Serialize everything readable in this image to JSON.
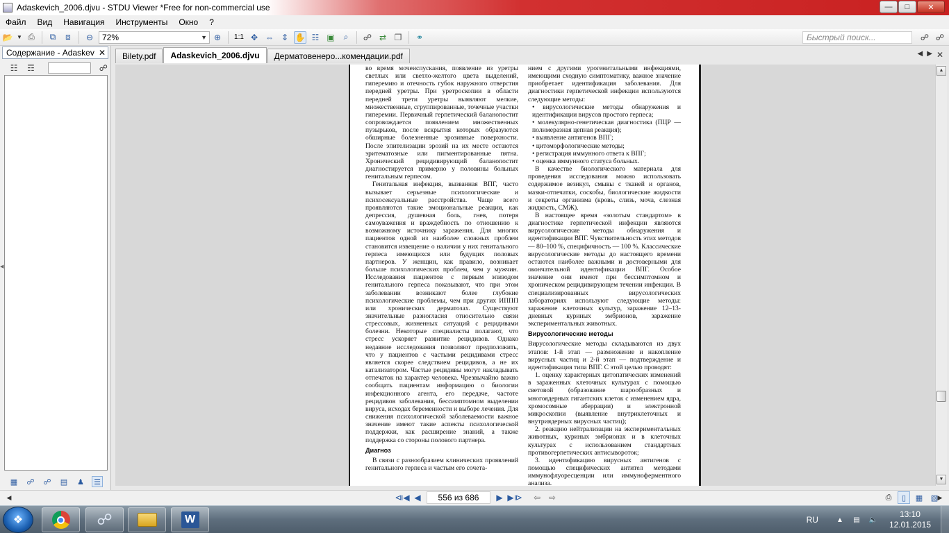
{
  "window": {
    "title": "Adaskevich_2006.djvu - STDU Viewer *Free for non-commercial use",
    "minimize_icon": "minimize-icon",
    "maximize_icon": "maximize-icon",
    "close_icon": "close-icon"
  },
  "menu": {
    "items": [
      "Файл",
      "Вид",
      "Навигация",
      "Инструменты",
      "Окно",
      "?"
    ]
  },
  "toolbar": {
    "zoom_value": "72%",
    "actual_size_label": "1:1",
    "search_placeholder": "Быстрый поиск..."
  },
  "left_panel": {
    "header": "Содержание - Adaskev",
    "close_label": "✕",
    "search_value": ""
  },
  "tabs": [
    {
      "label": "Bilety.pdf",
      "active": false
    },
    {
      "label": "Adaskevich_2006.djvu",
      "active": true
    },
    {
      "label": "Дерматовенеро...комендации.pdf",
      "active": false
    }
  ],
  "document": {
    "left_column": [
      {
        "type": "p",
        "text": "во время мочеиспускания, появление из уретры светлых или светло-желтого цвета выделений, гиперемию и отечность губок наружного отверстия передней уретры. При уретроскопии в области передней трети уретры выявляют мелкие, множественные, сгруппированные, точечные участки гиперемии. Первичный герпетический баланопостит сопровождается появлением множественных пузырьков, после вскрытия которых образуются обширные болезненные эрозивные поверхности. После эпителизации эрозий на их месте остаются эритематозные или пигментированные пятна. Хронический рецидивирующий баланопостит диагностируется примерно у половины больных генитальным герпесом."
      },
      {
        "type": "ind",
        "text": "Генитальная инфекция, вызванная ВПГ, часто вызывает серьезные психологические и психосексуальные расстройства. Чаще всего проявляются такие эмоциональные реакции, как депрессия, душевная боль, гнев, потеря самоуважения и враждебность по отношению к возможному источнику заражения. Для многих пациентов одной из наиболее сложных проблем становится извещение о наличии у них генитального герпеса имеющихся или будущих половых партнеров. У женщин, как правило, возникает больше психологических проблем, чем у мужчин. Исследования пациентов с первым эпизодом генитального герпеса показывают, что при этом заболевании возникают более глубокие психологические проблемы, чем при других ИППП или хронических дерматозах. Существуют значительные разногласия относительно связи стрессовых, жизненных ситуаций с рецидивами болезни. Некоторые специалисты полагают, что стресс ускоряет развитие рецидивов. Однако недавние исследования позволяют предположить, что у пациентов с частыми рецидивами стресс является скорее следствием рецидивов, а не их катализатором. Частые рецидивы могут накладывать отпечаток на характер человека. Чрезвычайно важно сообщать пациентам информацию о биологии инфекционного агента, его передаче, частоте рецидивов заболевания, бессимптомном выделении вируса, исходах беременности и выборе лечения. Для снижения психологической заболеваемости важное значение имеют такие аспекты психологической поддержки, как расширение знаний, а также поддержка со стороны полового партнера."
      },
      {
        "type": "head",
        "text": "Диагноз"
      },
      {
        "type": "ind",
        "text": "В связи с разнообразием клинических проявлений генитального герпеса и частым его сочета-"
      }
    ],
    "right_column": [
      {
        "type": "p",
        "text": "нием с другими урогенитальными инфекциями, имеющими сходную симптоматику, важное значение приобретает идентификация заболевания. Для диагностики герпетической инфекции используются следующие методы:"
      },
      {
        "type": "list",
        "items": [
          "вирусологические методы обнаружения и идентификации вирусов простого герпеса;",
          "молекулярно-генетическая диагностика (ПЦР — полимеразная цепная реакция);",
          "выявление антигенов ВПГ;",
          "цитоморфологические методы;",
          "регистрация иммунного ответа к ВПГ;",
          "оценка иммунного статуса больных."
        ]
      },
      {
        "type": "ind",
        "text": "В качестве биологического материала для проведения исследования можно использовать содержимое везикул, смывы с тканей и органов, мазки-отпечатки, соскобы, биологические жидкости и секреты организма (кровь, слизь, моча, слезная жидкость, СМЖ)."
      },
      {
        "type": "ind",
        "text": "В настоящее время «золотым стандартом» в диагностике герпетической инфекции являются вирусологические методы обнаружения и идентификации ВПГ. Чувствительность этих методов — 80–100 %, специфичность — 100 %. Классические вирусологические методы до настоящего времени остаются наиболее важными и достоверными для окончательной идентификации ВПГ. Особое значение они имеют при бессимптомном и хроническом рецидивирующем течении инфекции. В специализированных вирусологических лабораториях используют следующие методы: заражение клеточных культур, заражение 12–13-дневных куриных эмбрионов, заражение экспериментальных животных."
      },
      {
        "type": "head",
        "text": "Вирусологические методы"
      },
      {
        "type": "p",
        "text": "Вирусологические методы складываются из двух этапов: 1-й этап — размножение и накопление вирусных частиц и 2-й этап — подтверждение и идентификация типа ВПГ. С этой целью проводят:"
      },
      {
        "type": "ind",
        "text": "1. оценку характерных цитопатических изменений в зараженных клеточных культурах с помощью световой (образование шарообразных и многоядерных гигантских клеток с изменением ядра, хромосомные аберрации) и электронной микроскопии (выявление внутриклеточных и внутриядерных вирусных частиц);"
      },
      {
        "type": "ind",
        "text": "2. реакцию нейтрализации на экспериментальных животных, куриных эмбрионах и в клеточных культурах с использованием стандартных противогерпетических антисывороток;"
      },
      {
        "type": "ind",
        "text": "3. идентификацию вирусных антигенов с помощью специфических антител методами иммунофлуоресценции или иммуноферментного анализа."
      }
    ]
  },
  "status": {
    "page_indicator": "556 из 686"
  },
  "taskbar": {
    "apps": [
      "chrome",
      "search-app",
      "file-explorer",
      "word"
    ],
    "lang": "RU",
    "time": "13:10",
    "date": "12.01.2015"
  },
  "colors": {
    "title_gradient_end": "#c82020",
    "accent": "#2a5aa0"
  }
}
